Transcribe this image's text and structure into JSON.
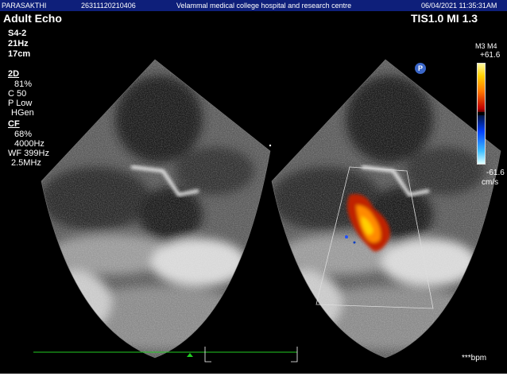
{
  "header": {
    "patient_name": "PARASAKTHI",
    "patient_id": "26311120210406",
    "institution": "Velammal medical college hospital and research centre",
    "datetime": "06/04/2021 11:35:31AM"
  },
  "left_panel": {
    "preset": "Adult Echo",
    "probe": "S4-2",
    "frame_rate": "21Hz",
    "depth": "17cm",
    "mode_2d_label": "2D",
    "mode_2d_params": [
      "81%",
      "C 50",
      "P Low",
      "HGen"
    ],
    "mode_cf_label": "CF",
    "mode_cf_params": [
      "68%",
      "4000Hz",
      "WF 399Hz",
      "2.5MHz"
    ]
  },
  "right_panel": {
    "tis_mi": "TIS1.0   MI 1.3",
    "map_label": "M3 M4",
    "scale_top": "+61.6",
    "scale_bottom": "-61.6",
    "scale_unit": "cm/s",
    "p_icon": "P",
    "heart_rate": "***bpm"
  },
  "colors": {
    "header_bg": "#0e1f7a",
    "ecg_line": "#22cc22",
    "doppler_red": "#d02000",
    "doppler_yellow": "#ffcc00"
  }
}
